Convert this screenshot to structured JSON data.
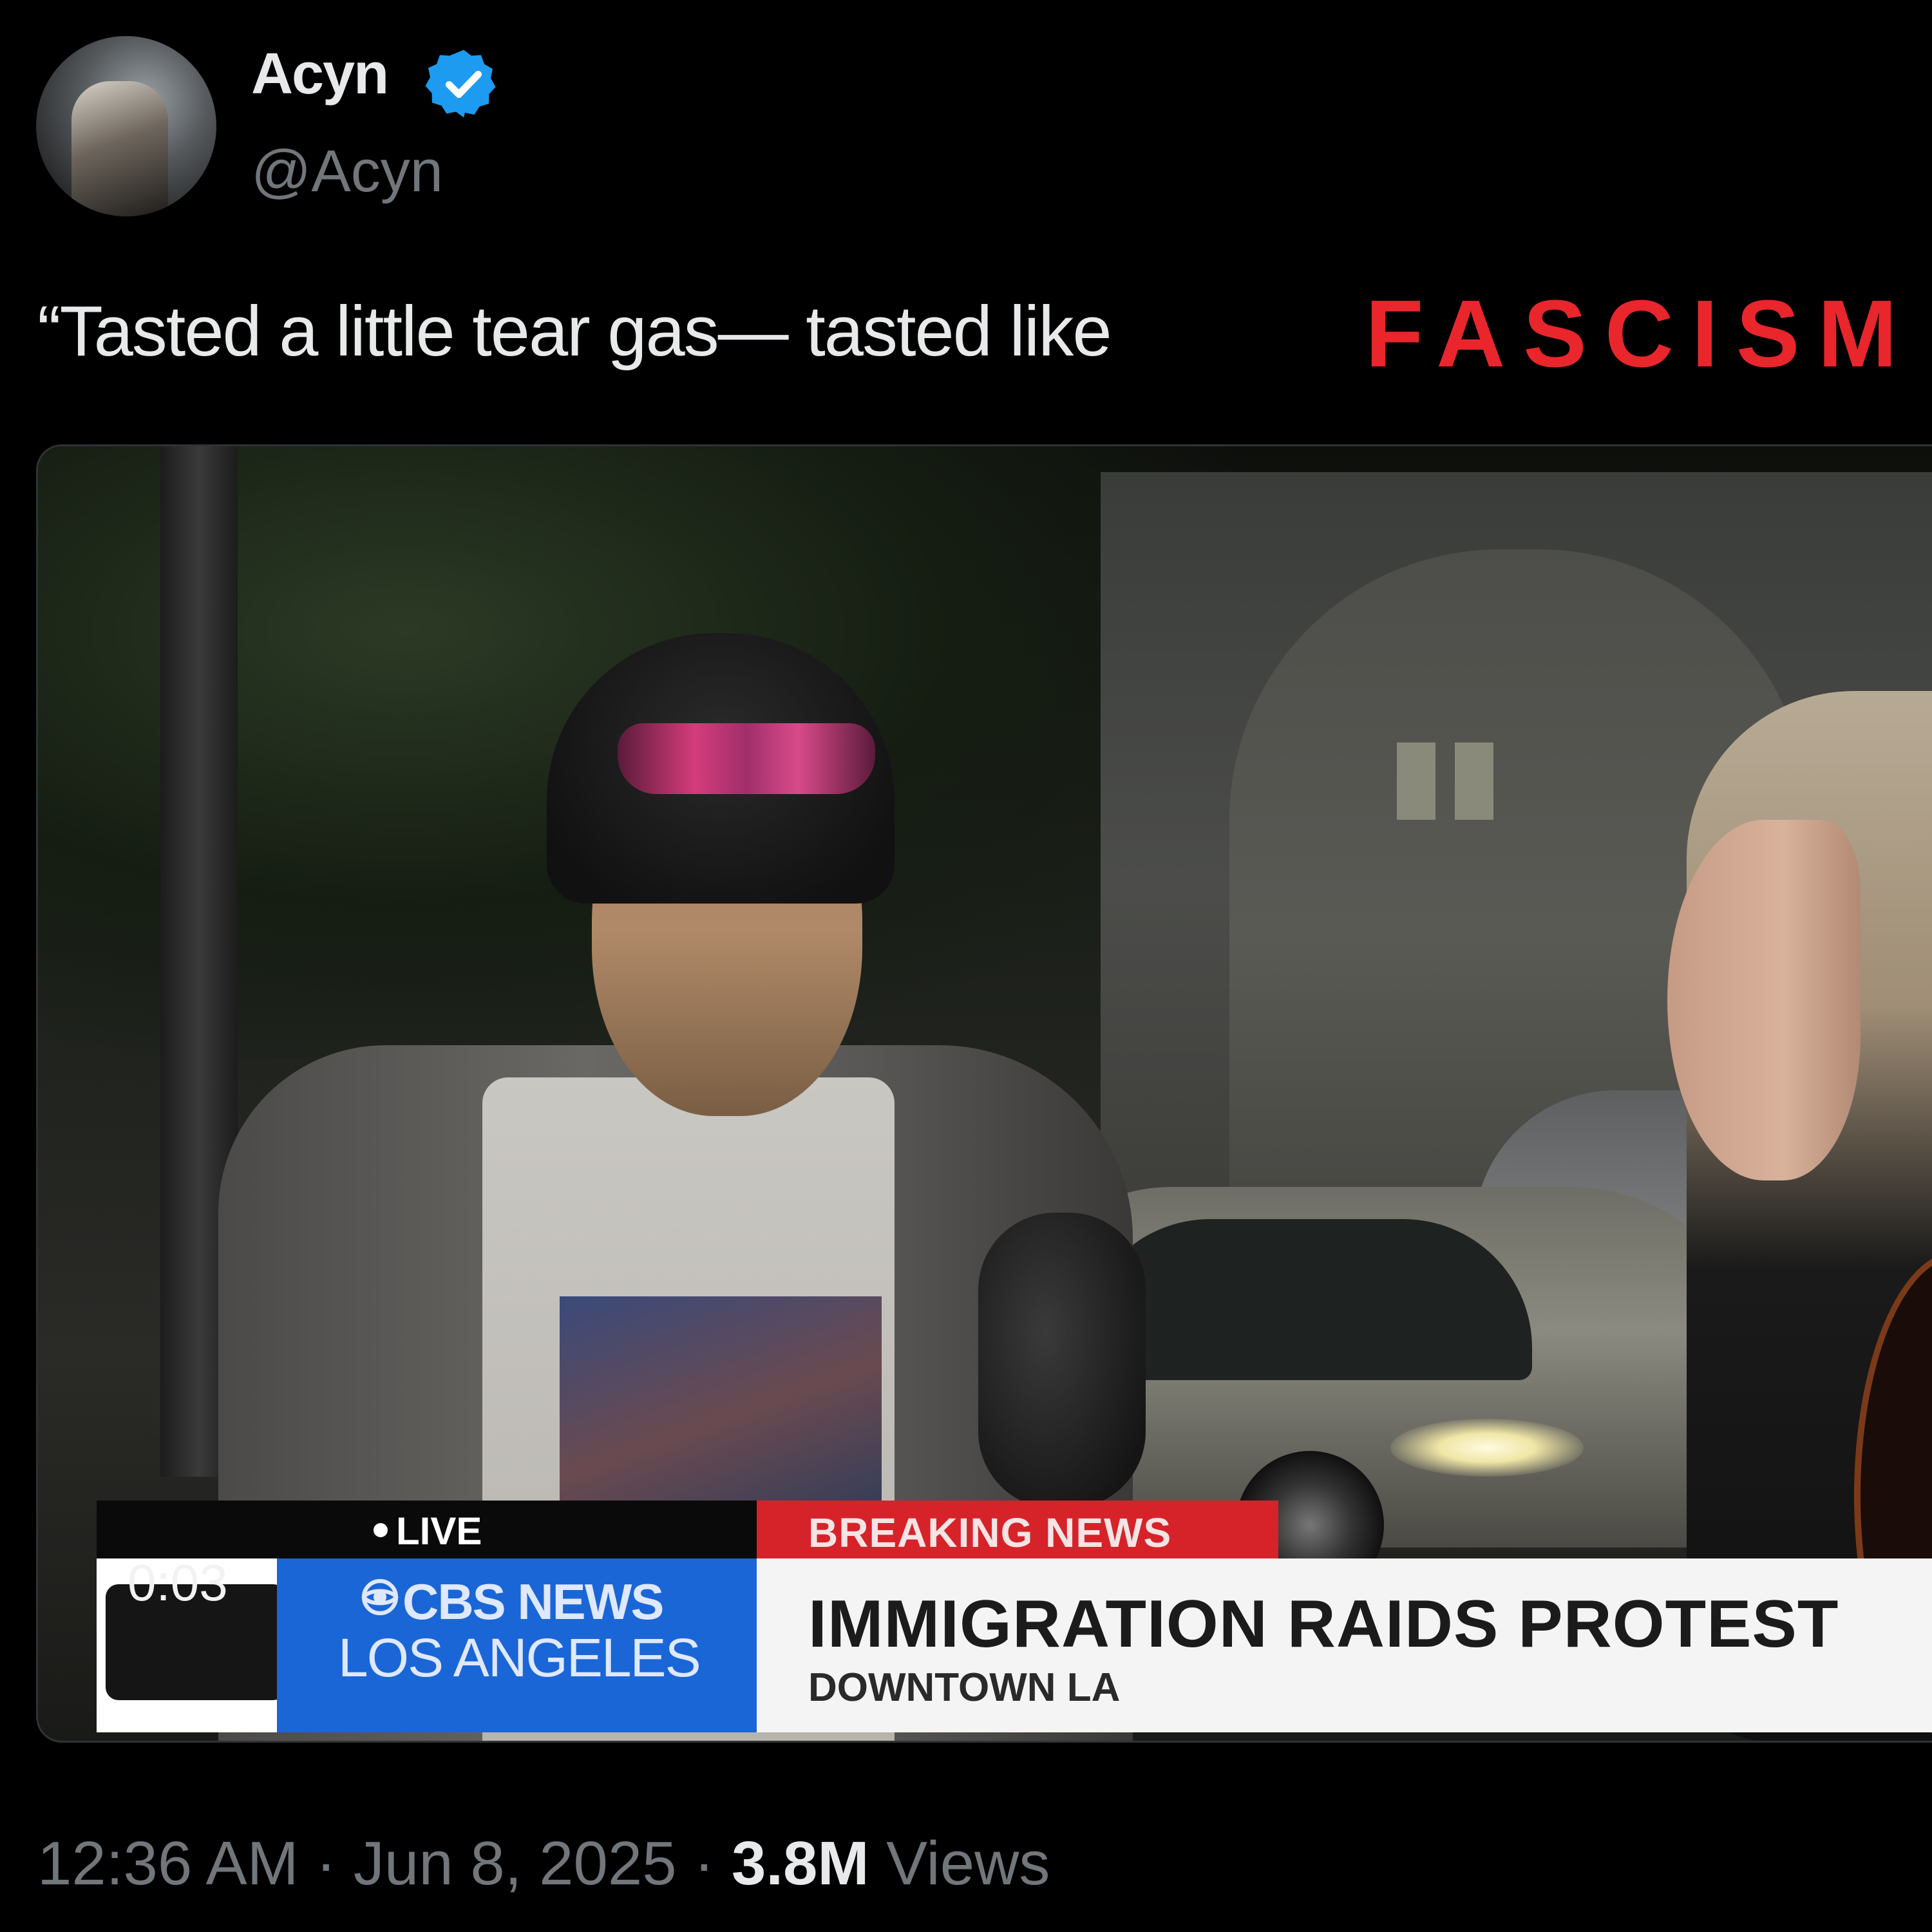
{
  "author": {
    "name": "Acyn",
    "handle": "@Acyn",
    "verified": true
  },
  "tweet": {
    "text": "“Tasted a little tear gas— tasted like",
    "emphasis": "FASCISM"
  },
  "video": {
    "timer": "0:03",
    "live_label": "LIVE",
    "breaking_label": "BREAKING NEWS",
    "network": "CBS NEWS",
    "station_city": "LOS ANGELES",
    "headline": "IMMIGRATION RAIDS PROTEST",
    "subheadline": "DOWNTOWN LA"
  },
  "meta": {
    "time": "12:36 AM",
    "separator": "·",
    "date": "Jun 8, 2025",
    "views_count": "3.8M",
    "views_label": "Views"
  },
  "colors": {
    "background": "#000000",
    "text_primary": "#e7e9ea",
    "text_secondary": "#71767b",
    "verified_blue": "#1d9bf0",
    "emphasis_red": "#e8262c",
    "cbs_blue": "#1a66d6",
    "breaking_red": "#d6232a"
  },
  "icons": {
    "verified": "verified-badge-icon",
    "cbs_logo": "cbs-eye-icon",
    "live_dot": "live-dot-icon"
  }
}
